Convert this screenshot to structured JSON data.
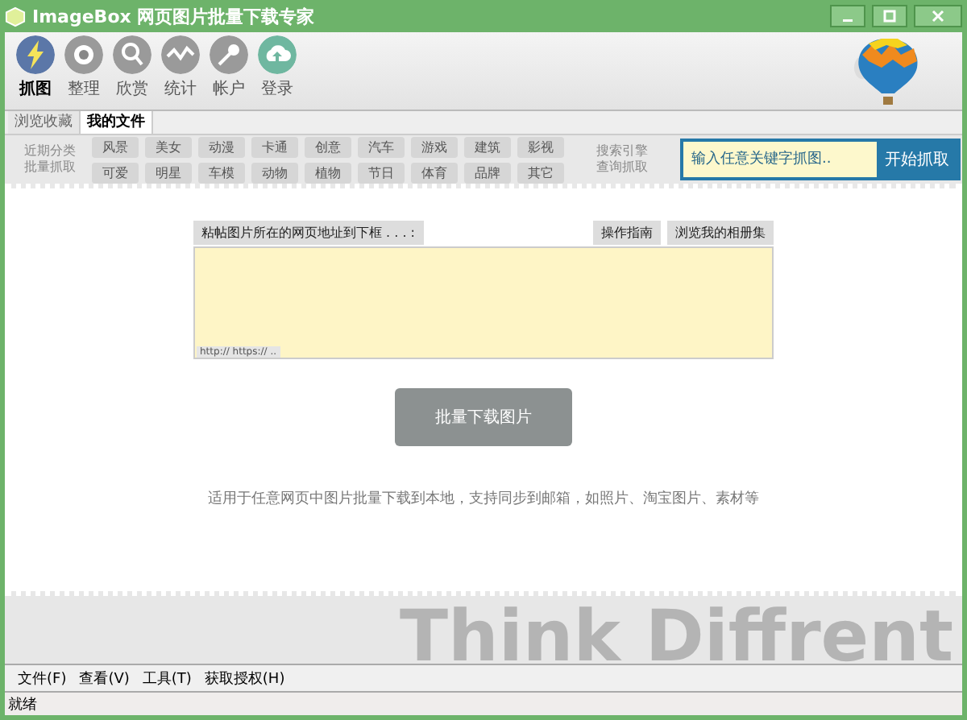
{
  "window": {
    "title": "ImageBox 网页图片批量下载专家"
  },
  "toolbar": [
    {
      "label": "抓图",
      "kind": "bolt",
      "color": "#5b77a8",
      "selected": true
    },
    {
      "label": "整理",
      "kind": "eye",
      "color": "#9a9a9a",
      "selected": false
    },
    {
      "label": "欣赏",
      "kind": "search",
      "color": "#9a9a9a",
      "selected": false
    },
    {
      "label": "统计",
      "kind": "wave",
      "color": "#9a9a9a",
      "selected": false
    },
    {
      "label": "帐户",
      "kind": "key",
      "color": "#9a9a9a",
      "selected": false
    },
    {
      "label": "登录",
      "kind": "upload",
      "color": "#6fb7a0",
      "selected": false
    }
  ],
  "tabs": [
    {
      "label": "浏览收藏",
      "selected": false
    },
    {
      "label": "我的文件",
      "selected": true
    }
  ],
  "categories": {
    "caption_lines": [
      "近期分类",
      "批量抓取"
    ],
    "items": [
      "风景",
      "美女",
      "动漫",
      "卡通",
      "创意",
      "汽车",
      "游戏",
      "建筑",
      "影视",
      "可爱",
      "明星",
      "车模",
      "动物",
      "植物",
      "节日",
      "体育",
      "品牌",
      "其它"
    ]
  },
  "search": {
    "caption_lines": [
      "搜索引擎",
      "查询抓取"
    ],
    "placeholder": "输入任意关键字抓图..",
    "button": "开始抓取"
  },
  "url_panel": {
    "label": "粘帖图片所在的网页地址到下框 . . . :",
    "buttons": [
      "操作指南",
      "浏览我的相册集"
    ],
    "hint": "http:// https:// .."
  },
  "download_button": "批量下载图片",
  "description": "适用于任意网页中图片批量下载到本地，支持同步到邮箱，如照片、淘宝图片、素材等",
  "banner_text": "Think Diffrent",
  "menu": [
    "文件(F)",
    "查看(V)",
    "工具(T)",
    "获取授权(H)"
  ],
  "status_bar": "就绪"
}
